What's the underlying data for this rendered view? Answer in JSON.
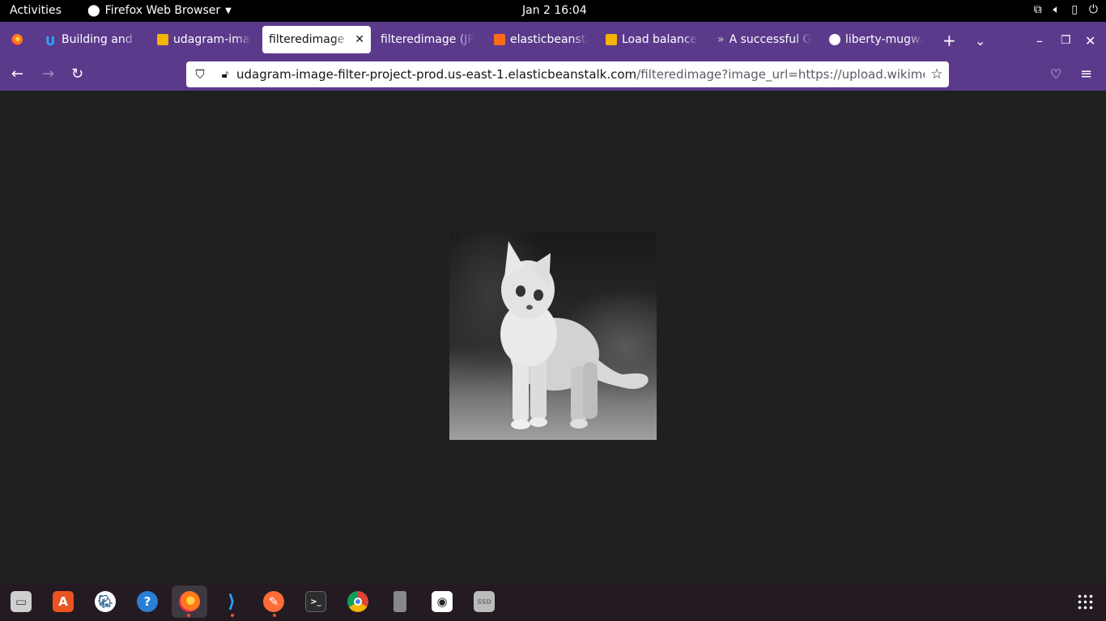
{
  "topbar": {
    "activities": "Activities",
    "app_name": "Firefox Web Browser",
    "clock": "Jan 2  16:04",
    "icons": [
      "network-icon",
      "volume-icon",
      "battery-icon",
      "power-icon"
    ]
  },
  "tabs": [
    {
      "label": "Building and D",
      "icon": "udacity-icon"
    },
    {
      "label": "udagram-imag",
      "icon": "aws-box-icon"
    },
    {
      "label": "filteredimage (J",
      "icon": "",
      "active": true
    },
    {
      "label": "filteredimage (JP",
      "icon": ""
    },
    {
      "label": "elasticbeansta",
      "icon": "elastic-beanstalk-icon"
    },
    {
      "label": "Load balancer",
      "icon": "aws-box-icon"
    },
    {
      "label": "A successful G",
      "icon": "chevrons-icon"
    },
    {
      "label": "liberty-mugwa",
      "icon": "github-icon"
    }
  ],
  "urlbar": {
    "host": "udagram-image-filter-project-prod.us-east-1.elasticbeanstalk.com",
    "path": "/filteredimage?image_url=https://upload.wikimedia.org/"
  },
  "content": {
    "image": "grayscale-kitten-photo"
  },
  "dock": {
    "apps": [
      "files",
      "software-center",
      "postgres",
      "help",
      "firefox",
      "vscode",
      "postman",
      "terminal",
      "chrome",
      "phone",
      "screenshot",
      "ssd"
    ]
  },
  "colors": {
    "browser_chrome": "#5b3a8c",
    "content_bg": "#202020",
    "dock_bg": "#231a22"
  }
}
